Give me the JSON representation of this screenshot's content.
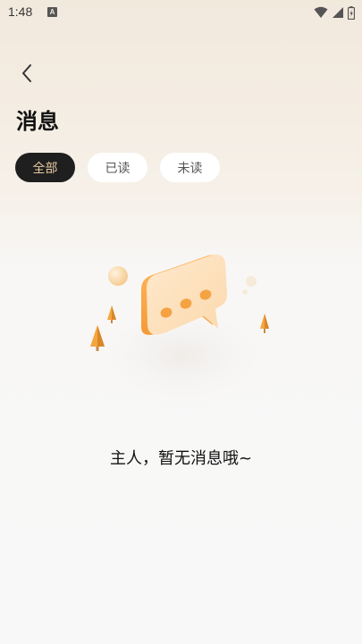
{
  "status_bar": {
    "time": "1:48",
    "notification_icon": "a-box-icon",
    "wifi_icon": "wifi-icon",
    "signal_icon": "signal-icon",
    "battery_icon": "battery-icon"
  },
  "header": {
    "back_icon": "chevron-left-icon",
    "title": "消息"
  },
  "tabs": [
    {
      "label": "全部",
      "active": true
    },
    {
      "label": "已读",
      "active": false
    },
    {
      "label": "未读",
      "active": false
    }
  ],
  "empty_state": {
    "illustration": "chat-bubble-illustration",
    "message": "主人，暂无消息哦~"
  },
  "colors": {
    "accent": "#e7c9a0",
    "active_tab_bg": "#1f1f1f",
    "bubble_orange": "#f7a94a"
  }
}
